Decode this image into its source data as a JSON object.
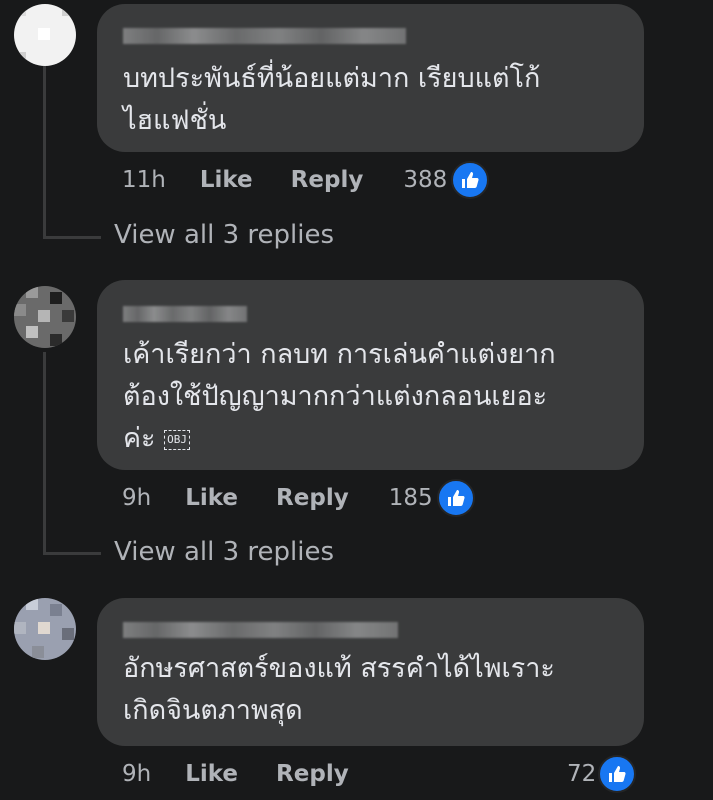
{
  "comments": [
    {
      "text": "บทประพันธ์ที่น้อยแต่มาก เรียบแต่โก้\nไฮแฟชั่น",
      "time": "11h",
      "like_label": "Like",
      "reply_label": "Reply",
      "reactions": "388",
      "view_replies": "View all 3 replies"
    },
    {
      "text": "เค้าเรียกว่า กลบท การเล่นคำแต่งยาก\nต้องใช้ปัญญามากกว่าแต่งกลอนเยอะ\nค่ะ ",
      "emoji_placeholder": "OBJ",
      "time": "9h",
      "like_label": "Like",
      "reply_label": "Reply",
      "reactions": "185",
      "view_replies": "View all 3 replies"
    },
    {
      "text": "อักษรศาสตร์ของแท้ สรรคำได้ไพเราะ\nเกิดจินตภาพสุด",
      "time": "9h",
      "like_label": "Like",
      "reply_label": "Reply",
      "reactions": "72"
    }
  ],
  "colors": {
    "background": "#18191a",
    "bubble": "#3a3b3c",
    "text": "#e4e6eb",
    "secondary_text": "#b0b3b8",
    "like_blue": "#1877f2"
  },
  "icons": {
    "reaction": "thumbs-up-icon"
  }
}
